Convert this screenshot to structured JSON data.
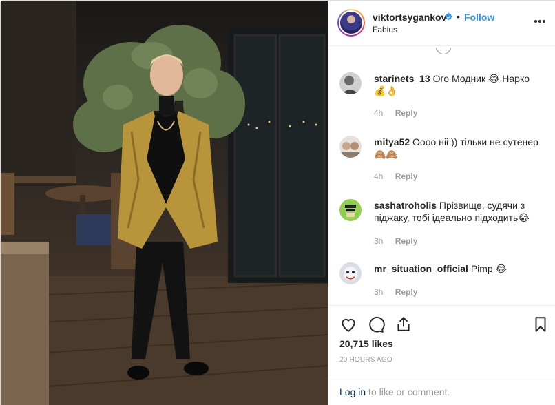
{
  "post": {
    "username": "viktortsygankov",
    "location": "Fabius",
    "follow_label": "Follow",
    "separator": "•"
  },
  "comments": [
    {
      "user": "starinets_13",
      "text": "Ого Модник 😂 Нарко 💰👌",
      "time": "4h",
      "reply": "Reply"
    },
    {
      "user": "mitya52",
      "text": "Оооо ніі )) тільки не сутенер 🙈🙈",
      "time": "4h",
      "reply": "Reply"
    },
    {
      "user": "sashatroholis",
      "text": "Прізвище, судячи з піджаку, тобі ідеально підходить😂",
      "time": "3h",
      "reply": "Reply"
    },
    {
      "user": "mr_situation_official",
      "text": "Pimp 😂",
      "time": "3h",
      "reply": "Reply"
    }
  ],
  "stats": {
    "likes": "20,715 likes",
    "posted": "20 HOURS AGO"
  },
  "login": {
    "link": "Log in",
    "rest": " to like or comment."
  },
  "colors": {
    "accent": "#3897f0",
    "border": "#efefef",
    "muted": "#999999",
    "jacket_gold": "#b8953a"
  },
  "icons": [
    "verified-badge-icon",
    "more-options-icon",
    "heart-icon",
    "comment-icon",
    "share-icon",
    "bookmark-icon"
  ]
}
